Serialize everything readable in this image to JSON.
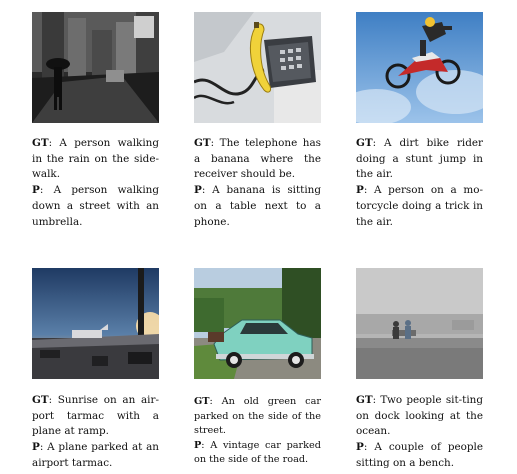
{
  "figure": {
    "rows": [
      [
        {
          "image": "photo of a person walking in the rain on a city sidewalk (black and white)",
          "gt_label": "GT",
          "gt_text": ": A person walking in the rain on the side-walk.",
          "p_label": "P",
          "p_text": ": A person walking down a street with an umbrella."
        },
        {
          "image": "photo of a telephone with a banana on the receiver cradle",
          "gt_label": "GT",
          "gt_text": ": The telephone has a banana where the receiver should be.",
          "p_label": "P",
          "p_text": ": A banana is sitting on a table next to a phone."
        },
        {
          "image": "photo of a dirt bike rider doing a stunt jump against the sky",
          "gt_label": "GT",
          "gt_text": ": A dirt bike rider doing a stunt jump in the air.",
          "p_label": "P",
          "p_text": ": A person on a mo-torcycle doing a trick in the air."
        }
      ],
      [
        {
          "image": "photo of sunrise over an airport tarmac with a plane at the ramp",
          "gt_label": "GT",
          "gt_text": ": Sunrise on an air-port tarmac with a plane at ramp.",
          "p_label": "P",
          "p_text": ": A plane parked at an airport tarmac."
        },
        {
          "image": "photo of an old green car parked on the side of the street",
          "gt_label": "GT",
          "gt_text": ": An old green car parked on the side of the street.",
          "p_label": "P",
          "p_text": ": A vintage car parked on the side of the road."
        },
        {
          "image": "photo of two people sitting on a dock looking at the ocean (grayscale)",
          "gt_label": "GT",
          "gt_text": ": Two people sit-ting on dock looking at the ocean.",
          "p_label": "P",
          "p_text": ": A couple of people sitting on a bench."
        }
      ]
    ]
  }
}
